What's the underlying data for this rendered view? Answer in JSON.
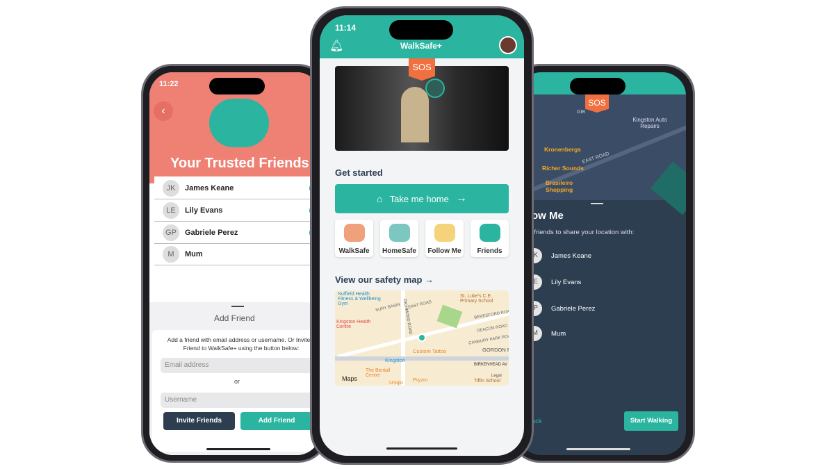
{
  "left_phone": {
    "time": "11:22",
    "title": "Your Trusted Friends",
    "friends": [
      {
        "initials": "JK",
        "name": "James Keane"
      },
      {
        "initials": "LE",
        "name": "Lily Evans"
      },
      {
        "initials": "GP",
        "name": "Gabriele Perez"
      },
      {
        "initials": "M",
        "name": "Mum"
      }
    ],
    "sheet": {
      "title": "Add Friend",
      "description": "Add a friend with email address or username. Or Invite a Friend to WalkSafe+ using the button below:",
      "email_placeholder": "Email address",
      "or": "or",
      "username_placeholder": "Username",
      "invite_label": "Invite Friends",
      "add_label": "Add Friend"
    }
  },
  "center_phone": {
    "time": "11:14",
    "app_title": "WalkSafe+",
    "sos": "SOS",
    "get_started": "Get started",
    "take_me_home": "Take me home",
    "tiles": [
      "WalkSafe",
      "HomeSafe",
      "Follow Me",
      "Friends"
    ],
    "map_heading": "View our safety map",
    "map_labels": {
      "gym": "Nuffield Health Fitness & Wellbeing Gym",
      "school": "St. Luke's C.E. Primary School",
      "health": "Kingston Health Centre",
      "richmond": "RICHMOND ROAD",
      "east": "EAST ROAD",
      "bury": "SURY BASIN",
      "beresford": "BERESFORD ROAD",
      "deacon": "DEACON ROAD",
      "canbury": "CANBURY PARK ROAD",
      "gordon": "GORDON R",
      "tattoo": "Custom Tattoo",
      "kingston": "Kingston",
      "bentall": "The Bentall Centre",
      "birkenhead": "BIRKENHEAD AV",
      "pryzm": "Pryzm",
      "uniqlo": "Uniqlo",
      "tiffin": "Tiffin School",
      "legal": "Legal",
      "maps": "Maps"
    },
    "colors": {
      "teal": "#2bb5a0",
      "sos": "#f0703f"
    }
  },
  "right_phone": {
    "sos": "SOS",
    "map_labels": {
      "repairs": "Kingston Auto Repairs",
      "kron": "Kronenbergs",
      "richer": "Richer Sounds",
      "brasil": "Brasileiro Shopping",
      "east": "EAST ROAD",
      "gib": "GIB"
    },
    "title": "ow Me",
    "subtitle": "t friends to share your location with:",
    "friends": [
      {
        "initials": "K",
        "name": "James Keane"
      },
      {
        "initials": "E",
        "name": "Lily Evans"
      },
      {
        "initials": "P",
        "name": "Gabriele Perez"
      },
      {
        "initials": "M",
        "name": "Mum"
      }
    ],
    "back": "ack",
    "start": "Start Walking"
  }
}
